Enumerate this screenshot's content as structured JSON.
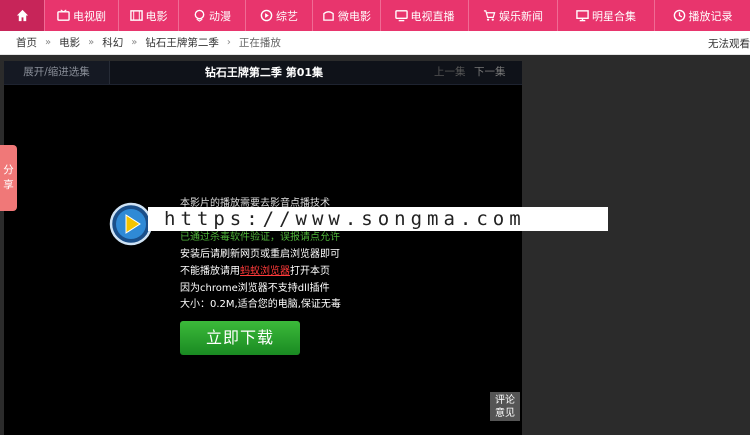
{
  "nav": {
    "items": [
      {
        "label": "电视剧",
        "icon": "tv-icon"
      },
      {
        "label": "电影",
        "icon": "film-icon"
      },
      {
        "label": "动漫",
        "icon": "cartoon-icon"
      },
      {
        "label": "综艺",
        "icon": "variety-icon"
      },
      {
        "label": "微电影",
        "icon": "mini-film-icon"
      },
      {
        "label": "电视直播",
        "icon": "live-tv-icon"
      },
      {
        "label": "娱乐新闻",
        "icon": "cart-icon"
      },
      {
        "label": "明星合集",
        "icon": "monitor-icon"
      },
      {
        "label": "播放记录",
        "icon": "clock-icon"
      }
    ]
  },
  "breadcrumb": {
    "items": [
      "首页",
      "电影",
      "科幻",
      "钻石王牌第二季"
    ],
    "current": "正在播放",
    "right_text": "无法观看"
  },
  "player": {
    "toggle_label": "展开/缩进选集",
    "title": "钻石王牌第二季 第01集",
    "prev_label": "上一集",
    "next_label": "下一集",
    "share_label_1": "分",
    "share_label_2": "享",
    "msg_line1": "本影片的播放需要去影音点播技术",
    "msg_line2": "已通过杀毒软件验证，误报请点允许",
    "msg_line3": "安装后请刷新网页或重启浏览器即可",
    "msg_line4_prefix": "不能播放请用",
    "msg_line4_link": "蚂蚁浏览器",
    "msg_line4_suffix": "打开本页",
    "msg_line5": "因为chrome浏览器不支持dll插件",
    "msg_line6": "大小：0.2M,适合您的电脑,保证无毒",
    "download_label": "立即下载",
    "feedback_label_1": "评论",
    "feedback_label_2": "意见"
  },
  "watermark": "https://www.songma.com"
}
